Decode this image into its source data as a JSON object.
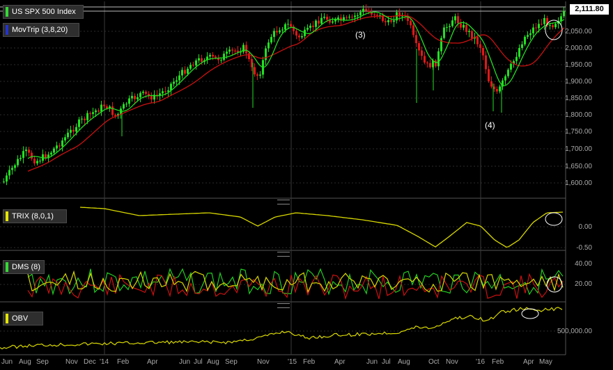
{
  "main_panel": {
    "legends": [
      {
        "label": "US SPX 500 Index",
        "color": "#36d936"
      },
      {
        "label": "MovTrip (3,8,20)",
        "color": "#2233cc"
      }
    ],
    "last_price": "2,111.80",
    "annotations": [
      "(3)",
      "(4)"
    ],
    "y_ticks": [
      "2,050.00",
      "2,000.00",
      "1,950.00",
      "1,900.00",
      "1,850.00",
      "1,800.00",
      "1,750.00",
      "1,700.00",
      "1,650.00",
      "1,600.00"
    ]
  },
  "trix_panel": {
    "legend": {
      "label": "TRIX (8,0,1)",
      "color": "#e6e600"
    },
    "y_ticks": [
      "0.00",
      "-0.50"
    ]
  },
  "dms_panel": {
    "legend": {
      "label": "DMS (8)",
      "color": "#36d936"
    },
    "y_ticks": [
      "40.00",
      "20.00"
    ]
  },
  "obv_panel": {
    "legend": {
      "label": "OBV",
      "color": "#e6e600"
    },
    "y_ticks": [
      "500,000.00"
    ]
  },
  "x_axis": [
    "Jun",
    "Aug",
    "Sep",
    "Nov",
    "Dec",
    "'14",
    "Feb",
    "Apr",
    "Jun",
    "Jul",
    "Aug",
    "Sep",
    "Nov",
    "'15",
    "Feb",
    "Apr",
    "Jun",
    "Jul",
    "Aug",
    "Oct",
    "Nov",
    "'16",
    "Feb",
    "Apr",
    "May"
  ],
  "colors": {
    "up": "#22e022",
    "down": "#e01818",
    "trix": "#d8d800",
    "ma_fast": "#22dd22",
    "ma_slow": "#cc1111",
    "grid": "#3a3a3a"
  }
}
